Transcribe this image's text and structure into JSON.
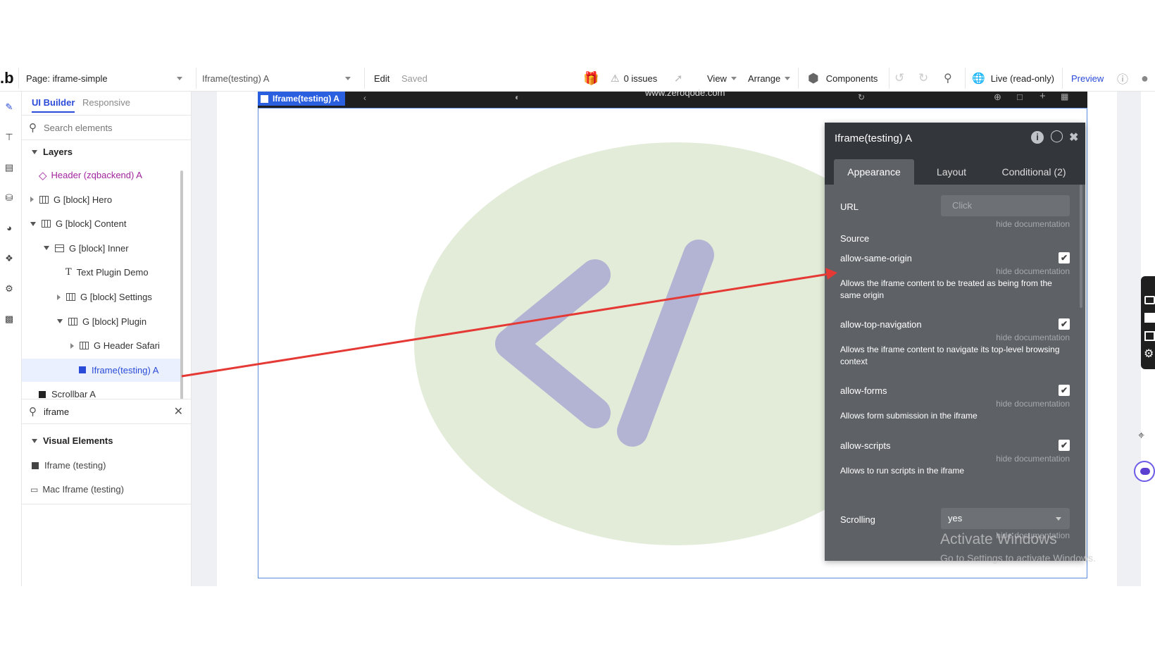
{
  "topbar": {
    "logo": ".b",
    "page_label": "Page: iframe-simple",
    "element_selector": "Iframe(testing) A",
    "edit": "Edit",
    "saved": "Saved",
    "issues": "0 issues",
    "view": "View",
    "arrange": "Arrange",
    "components": "Components",
    "live": "Live (read-only)",
    "preview": "Preview"
  },
  "left_rail": {
    "icons": [
      "pencil-icon",
      "hierarchy-icon",
      "layers-icon",
      "database-icon",
      "palette-icon",
      "plug-icon",
      "settings-icon",
      "chart-icon"
    ]
  },
  "builder_panel": {
    "tabs": [
      "UI Builder",
      "Responsive"
    ],
    "search_placeholder": "Search elements",
    "layers_title": "Layers",
    "layers": [
      {
        "label": "Header (zqbackend) A",
        "depth": 0,
        "toggle": "none",
        "icon": "diamond"
      },
      {
        "label": "G [block] Hero",
        "depth": 0,
        "toggle": "collapsed",
        "icon": "group"
      },
      {
        "label": "G [block] Content",
        "depth": 0,
        "toggle": "expanded",
        "icon": "group"
      },
      {
        "label": "G [block] Inner",
        "depth": 1,
        "toggle": "expanded",
        "icon": "rows"
      },
      {
        "label": "Text Plugin Demo",
        "depth": 2,
        "toggle": "none",
        "icon": "text"
      },
      {
        "label": "G [block] Settings",
        "depth": 2,
        "toggle": "collapsed",
        "icon": "group"
      },
      {
        "label": "G [block] Plugin",
        "depth": 2,
        "toggle": "expanded",
        "icon": "group"
      },
      {
        "label": "G Header Safari",
        "depth": 3,
        "toggle": "collapsed",
        "icon": "group"
      },
      {
        "label": "Iframe(testing) A",
        "depth": 3,
        "toggle": "none",
        "icon": "square-blue",
        "selected": true
      },
      {
        "label": "Scrollbar A",
        "depth": 0,
        "toggle": "none",
        "icon": "square-dark"
      }
    ],
    "element_search_value": "iframe",
    "visual_elements_title": "Visual Elements",
    "visual_elements": [
      "Iframe (testing)",
      "Mac Iframe (testing)"
    ]
  },
  "canvas": {
    "selected_tag": "Iframe(testing) A",
    "browser_url": "www.zeroqode.com"
  },
  "property_editor": {
    "title": "Iframe(testing) A",
    "tabs": [
      "Appearance",
      "Layout",
      "Conditional (2)"
    ],
    "url_label": "URL",
    "url_placeholder": "Click",
    "hide_doc": "hide documentation",
    "source_label": "Source",
    "options": [
      {
        "label": "allow-same-origin",
        "checked": true,
        "desc": "Allows the iframe content to be treated as being from the same origin"
      },
      {
        "label": "allow-top-navigation",
        "checked": true,
        "desc": "Allows the iframe content to navigate its top-level browsing context"
      },
      {
        "label": "allow-forms",
        "checked": true,
        "desc": "Allows form submission in the iframe"
      },
      {
        "label": "allow-scripts",
        "checked": true,
        "desc": "Allows to run scripts in the iframe"
      }
    ],
    "scrolling_label": "Scrolling",
    "scrolling_value": "yes"
  },
  "watermark": {
    "title": "Activate Windows",
    "subtitle": "Go to Settings to activate Windows."
  },
  "colors": {
    "accent": "#2a4bd8",
    "selected_layer": "#2a5fe0",
    "annotation_arrow": "#e53935",
    "panel_bg": "#5e6166",
    "panel_header": "#33363b",
    "logo_circle": "#e3ecd9",
    "logo_glyph": "#b3b4d3"
  }
}
